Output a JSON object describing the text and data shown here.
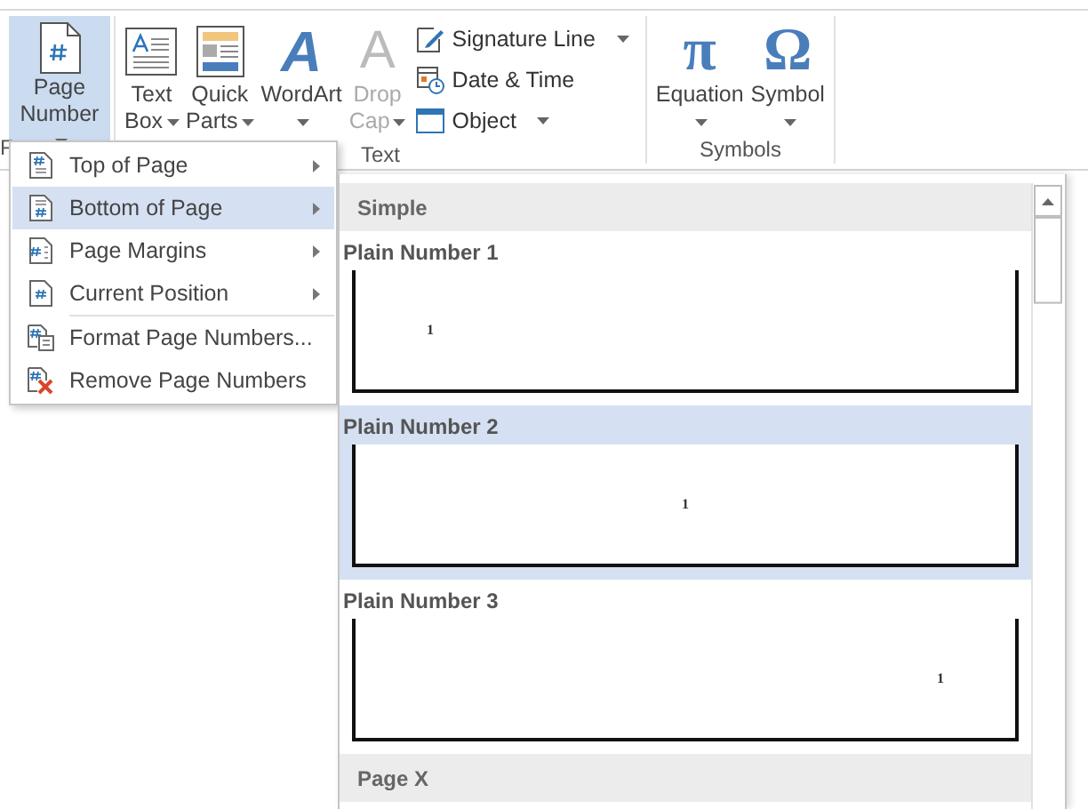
{
  "ribbon": {
    "groups": [
      {
        "label": "F",
        "buttons": [
          {
            "kind": "page-number",
            "lines": [
              "Page",
              "Number"
            ],
            "dropdown": true,
            "selected": true,
            "disabled": false
          }
        ]
      },
      {
        "label": "Text",
        "buttons": [
          {
            "kind": "text-box",
            "lines": [
              "Text",
              "Box"
            ],
            "dropdown": true,
            "selected": false,
            "disabled": false
          },
          {
            "kind": "quick-parts",
            "lines": [
              "Quick",
              "Parts"
            ],
            "dropdown": true,
            "selected": false,
            "disabled": false
          },
          {
            "kind": "wordart",
            "glyph": "A",
            "lines": [
              "WordArt"
            ],
            "dropdown": true,
            "selected": false,
            "disabled": false
          },
          {
            "kind": "drop-cap",
            "glyph": "A",
            "lines": [
              "Drop",
              "Cap"
            ],
            "dropdown": true,
            "selected": false,
            "disabled": true
          }
        ],
        "small_buttons": [
          {
            "kind": "signature",
            "label": "Signature Line",
            "dropdown": true
          },
          {
            "kind": "date-time",
            "label": "Date & Time",
            "dropdown": false
          },
          {
            "kind": "object",
            "label": "Object",
            "dropdown": true
          }
        ]
      },
      {
        "label": "Symbols",
        "buttons": [
          {
            "kind": "equation",
            "glyph": "π",
            "lines": [
              "Equation"
            ],
            "dropdown": true,
            "selected": false,
            "disabled": false
          },
          {
            "kind": "symbol",
            "glyph": "Ω",
            "lines": [
              "Symbol"
            ],
            "dropdown": true,
            "selected": false,
            "disabled": false
          }
        ]
      }
    ]
  },
  "menu": {
    "sections": [
      [
        {
          "kind": "top",
          "label": "Top of Page",
          "submenu": true,
          "selected": false
        },
        {
          "kind": "bottom",
          "label": "Bottom of Page",
          "submenu": true,
          "selected": true
        },
        {
          "kind": "margins",
          "label": "Page Margins",
          "submenu": true,
          "selected": false
        },
        {
          "kind": "current",
          "label": "Current Position",
          "submenu": true,
          "selected": false
        }
      ],
      [
        {
          "kind": "format",
          "label": "Format Page Numbers...",
          "submenu": false,
          "selected": false
        },
        {
          "kind": "remove",
          "label": "Remove Page Numbers",
          "submenu": false,
          "selected": false
        }
      ]
    ]
  },
  "gallery": {
    "sections": [
      {
        "heading": "Simple",
        "entries": [
          {
            "name": "Plain Number 1",
            "kind": "left",
            "preview_number": "1",
            "selected": false
          },
          {
            "name": "Plain Number 2",
            "kind": "center",
            "preview_number": "1",
            "selected": true
          },
          {
            "name": "Plain Number 3",
            "kind": "right",
            "preview_number": "1",
            "selected": false
          }
        ]
      },
      {
        "heading": "Page X"
      }
    ]
  }
}
